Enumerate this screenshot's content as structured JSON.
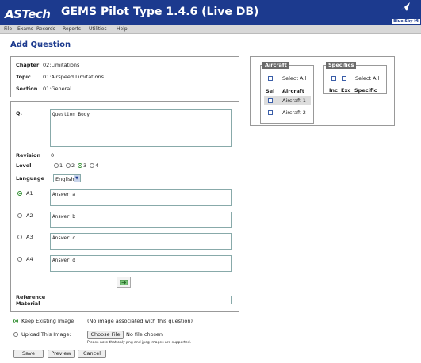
{
  "header": {
    "logo": "ASTech",
    "title": "GEMS Pilot Type 1.4.6 (Live DB)",
    "brand": "Blue Sky Mi"
  },
  "menu": [
    "File",
    "Exams",
    "Records",
    "Reports",
    "Utilities",
    "Help"
  ],
  "page_title": "Add Question",
  "info": {
    "chapter_label": "Chapter",
    "chapter_value": "02:Limitations",
    "topic_label": "Topic",
    "topic_value": "01:Airspeed Limitations",
    "section_label": "Section",
    "section_value": "01:General"
  },
  "form": {
    "q_label": "Q.",
    "question_body": "Question Body",
    "revision_label": "Revision",
    "revision_value": "0",
    "level_label": "Level",
    "levels": [
      "1",
      "2",
      "3",
      "4"
    ],
    "level_selected": "3",
    "language_label": "Language",
    "language_value": "English",
    "answers": [
      {
        "label": "A1",
        "value": "Answer a",
        "selected": true
      },
      {
        "label": "A2",
        "value": "Answer b",
        "selected": false
      },
      {
        "label": "A3",
        "value": "Answer c",
        "selected": false
      },
      {
        "label": "A4",
        "value": "Answer d",
        "selected": false
      }
    ],
    "reference_label_1": "Reference",
    "reference_label_2": "Material",
    "reference_value": ""
  },
  "image": {
    "keep_label": "Keep Existing Image:",
    "keep_note": "(No image associated with this question)",
    "upload_label": "Upload This Image:",
    "choose_file": "Choose File",
    "no_file": "No file chosen",
    "upload_note": "Please note that only png and jpeg images are supported."
  },
  "buttons": {
    "save": "Save",
    "preview": "Preview",
    "cancel": "Cancel"
  },
  "aircraft": {
    "legend": "Aircraft",
    "select_all": "Select All",
    "col_sel": "Sel",
    "col_aircraft": "Aircraft",
    "items": [
      "Aircraft 1",
      "Aircraft 2"
    ]
  },
  "specifics": {
    "legend": "Specifics",
    "select_all": "Select All",
    "col_inc": "Inc",
    "col_exc": "Exc",
    "col_specific": "Specific"
  },
  "colors": {
    "header": "#1c3a8e",
    "accent": "#2a8a2a",
    "legend_bg": "#6b6b6b"
  }
}
